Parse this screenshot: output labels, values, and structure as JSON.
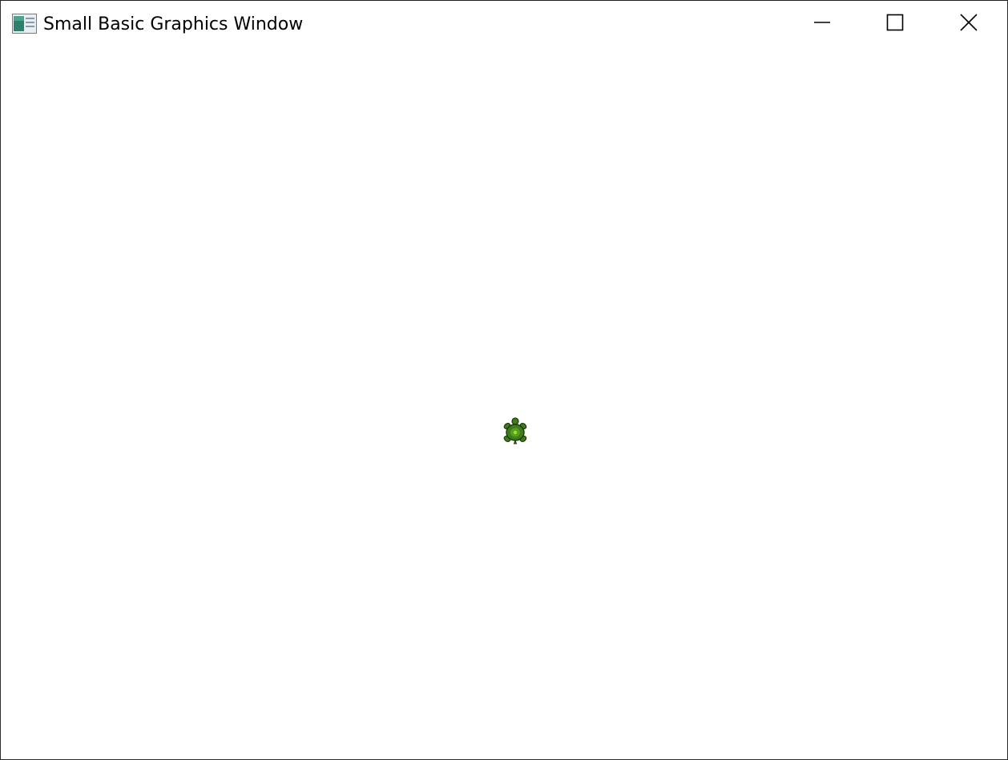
{
  "window": {
    "title": "Small Basic Graphics Window",
    "app_icon": "small-basic-window-icon",
    "controls": {
      "minimize_icon": "minimize-icon",
      "maximize_icon": "maximize-icon",
      "close_icon": "close-icon"
    }
  },
  "canvas": {
    "background": "#ffffff",
    "turtle": {
      "icon": "turtle-icon",
      "shell_color": "#3f7d1a",
      "outline_color": "#1e3a0a",
      "highlight_color": "#9be02a"
    }
  }
}
